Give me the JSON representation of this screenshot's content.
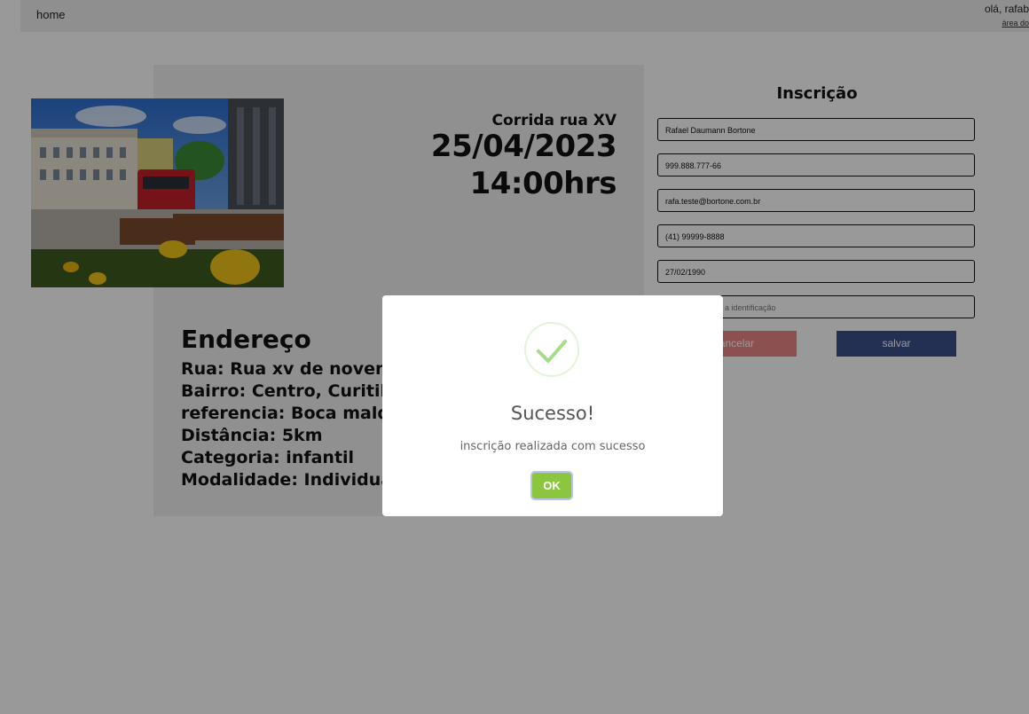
{
  "navbar": {
    "home": "home",
    "greeting": "olá, rafab",
    "area_link": "área do"
  },
  "event": {
    "name": "Corrida rua XV",
    "date": "25/04/2023",
    "time": "14:00hrs",
    "photo_icon": "city-street-photo"
  },
  "address": {
    "title": "Endereço",
    "lines": [
      "Rua: Rua xv de novembro",
      "Bairro: Centro, Curitiba",
      "referencia: Boca maldita",
      "Distância: 5km",
      "Categoria: infantil",
      "Modalidade: Individual"
    ]
  },
  "form": {
    "title": "Inscrição",
    "fields": [
      {
        "value": "Rafael Daumann Bortone"
      },
      {
        "value": "999.888.777-66"
      },
      {
        "value": "rafa.teste@bortone.com.br"
      },
      {
        "value": "(41) 99999-8888"
      },
      {
        "value": "27/02/1990"
      },
      {
        "placeholder": "a identificação"
      }
    ],
    "cancel_label": "ancelar",
    "save_label": "salvar"
  },
  "modal": {
    "icon": "checkmark-icon",
    "title": "Sucesso!",
    "message": "inscrição realizada com sucesso",
    "ok_label": "OK",
    "colors": {
      "ok": "#8cc63f",
      "check": "#a5dc86"
    }
  }
}
